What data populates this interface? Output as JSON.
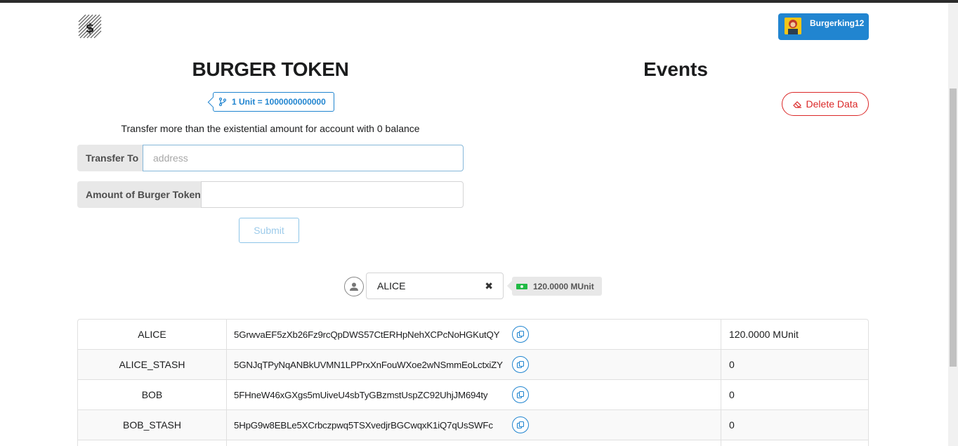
{
  "header": {
    "logo_icon": "substrate-logo-icon",
    "user": {
      "name": "Burgerking12",
      "avatar_icon": "user-avatar-icon",
      "color": "#2185d0"
    }
  },
  "transfer": {
    "title": "BURGER TOKEN",
    "unit_label": "1 Unit = 1000000000000",
    "unit_icon": "branch-icon",
    "hint": "Transfer more than the existential amount for account with 0 balance",
    "to_label": "Transfer To",
    "to_placeholder": "address",
    "amount_label": "Amount of Burger Token",
    "amount_value": "",
    "submit_label": "Submit"
  },
  "events": {
    "title": "Events",
    "delete_label": "Delete Data",
    "delete_icon": "eraser-icon",
    "delete_color": "#db2828"
  },
  "account_selector": {
    "selected": "ALICE",
    "balance": "120.0000 MUnit",
    "avatar_icon": "user-circle-icon",
    "clear_icon": "close-icon",
    "money_icon": "money-icon"
  },
  "accounts": [
    {
      "name": "ALICE",
      "address": "5GrwvaEF5zXb26Fz9rcQpDWS57CtERHpNehXCPcNoHGKutQY",
      "balance": "120.0000 MUnit"
    },
    {
      "name": "ALICE_STASH",
      "address": "5GNJqTPyNqANBkUVMN1LPPrxXnFouWXoe2wNSmmEoLctxiZY",
      "balance": "0"
    },
    {
      "name": "BOB",
      "address": "5FHneW46xGXgs5mUiveU4sbTyGBzmstUspZC92UhjJM694ty",
      "balance": "0"
    },
    {
      "name": "BOB_STASH",
      "address": "5HpG9w8EBLe5XCrbczpwq5TSXvedjrBGCwqxK1iQ7qUsSWFc",
      "balance": "0"
    }
  ]
}
